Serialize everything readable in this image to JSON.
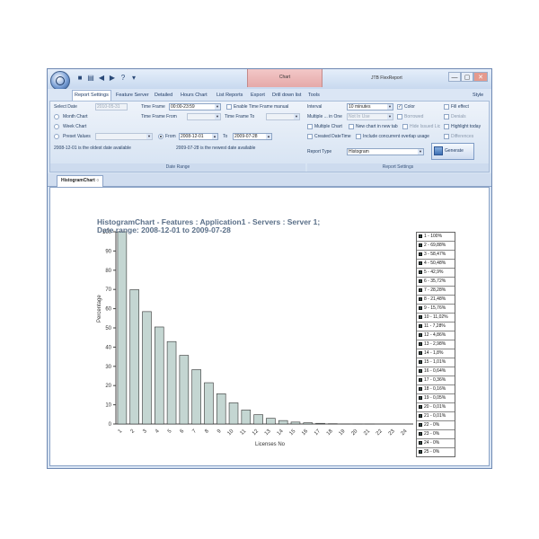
{
  "app": {
    "title": "JTB FlexReport",
    "context_tab": "Chart",
    "window_buttons": [
      "—",
      "▢",
      "✕"
    ]
  },
  "menu": [
    "Report Settings",
    "Feature Server",
    "Detailed",
    "Hours Chart",
    "List Reports",
    "Export",
    "Drill down list",
    "Tools"
  ],
  "menu_right": "Style",
  "ribbon": {
    "select_date_label": "Select Date",
    "select_date_value": "2010-05-31",
    "time_frame_label": "Time Frame",
    "time_frame_value": "00:00-23:59",
    "enable_time_frame_label": "Enable Time Frame manual",
    "month_chart_label": "Month Chart",
    "time_frame_from_label": "Time Frame From",
    "time_frame_to_label": "Time Frame To",
    "week_chart_label": "Week Chart",
    "preset_values_label": "Preset Values",
    "from_label": "From",
    "from_value": "2008-12-01",
    "to_label": "To",
    "to_value": "2009-07-28",
    "oldest_note": "2008-12-01 is the oldest date available",
    "newest_note": "2009-07-28 is the newest date available",
    "group_date_range": "Date Range",
    "interval_label": "Interval",
    "interval_value": "10 minutes",
    "color_label": "Color",
    "fill_effect_label": "Fill effect",
    "multiple_label": "Multiple ... in One",
    "multiple_value": "Not In Use",
    "borrowed_label": "Borrowed",
    "denials_label": "Denials",
    "multiple_chart_label": "Multiple Chart",
    "new_chart_label": "New chart in new tab",
    "hide_issued_label": "Hide Issued Lic",
    "highlight_today_label": "Highlight today",
    "created_datetime_label": "Created DateTime",
    "include_overlap_label": "Include concurrent overlap usage",
    "differences_label": "Differences",
    "report_type_label": "Report Type",
    "report_type_value": "Histogram",
    "generate_chart_label": "Generate Chart",
    "group_report_settings": "Report Settings"
  },
  "doc_tab": "HistogramChart",
  "chart_data": {
    "type": "bar",
    "title": "HistogramChart - Features : Application1 - Servers : Server 1;\nDate range: 2008-12-01 to 2009-07-28",
    "xlabel": "Licenses No",
    "ylabel": "Percentage",
    "ylim": [
      0,
      100
    ],
    "yticks": [
      0,
      10,
      20,
      30,
      40,
      50,
      60,
      70,
      80,
      90,
      100
    ],
    "categories": [
      "1",
      "2",
      "3",
      "4",
      "5",
      "6",
      "7",
      "8",
      "9",
      "10",
      "11",
      "12",
      "13",
      "14",
      "15",
      "16",
      "17",
      "18",
      "19",
      "20",
      "21",
      "22",
      "23",
      "24"
    ],
    "values": [
      100,
      69.88,
      58.47,
      50.48,
      42.9,
      35.72,
      28.28,
      21.48,
      15.76,
      11.02,
      7.28,
      4.86,
      2.98,
      1.8,
      1.01,
      0.64,
      0.36,
      0.16,
      0.05,
      0.01,
      0.01,
      0,
      0,
      0
    ],
    "bar_color": "#c4d6d2",
    "bar_stroke": "#333333",
    "grid": false,
    "legend_position": "right",
    "legend": [
      "1 - 100%",
      "2 - 69,88%",
      "3 - 58,47%",
      "4 - 50,48%",
      "5 - 42,9%",
      "6 - 35,72%",
      "7 - 28,28%",
      "8 - 21,48%",
      "9 - 15,76%",
      "10 - 11,02%",
      "11 - 7,28%",
      "12 - 4,86%",
      "13 - 2,98%",
      "14 - 1,8%",
      "15 - 1,01%",
      "16 - 0,64%",
      "17 - 0,36%",
      "18 - 0,16%",
      "19 - 0,05%",
      "20 - 0,01%",
      "21 - 0,01%",
      "22 - 0%",
      "23 - 0%",
      "24 - 0%",
      "25 - 0%"
    ]
  }
}
